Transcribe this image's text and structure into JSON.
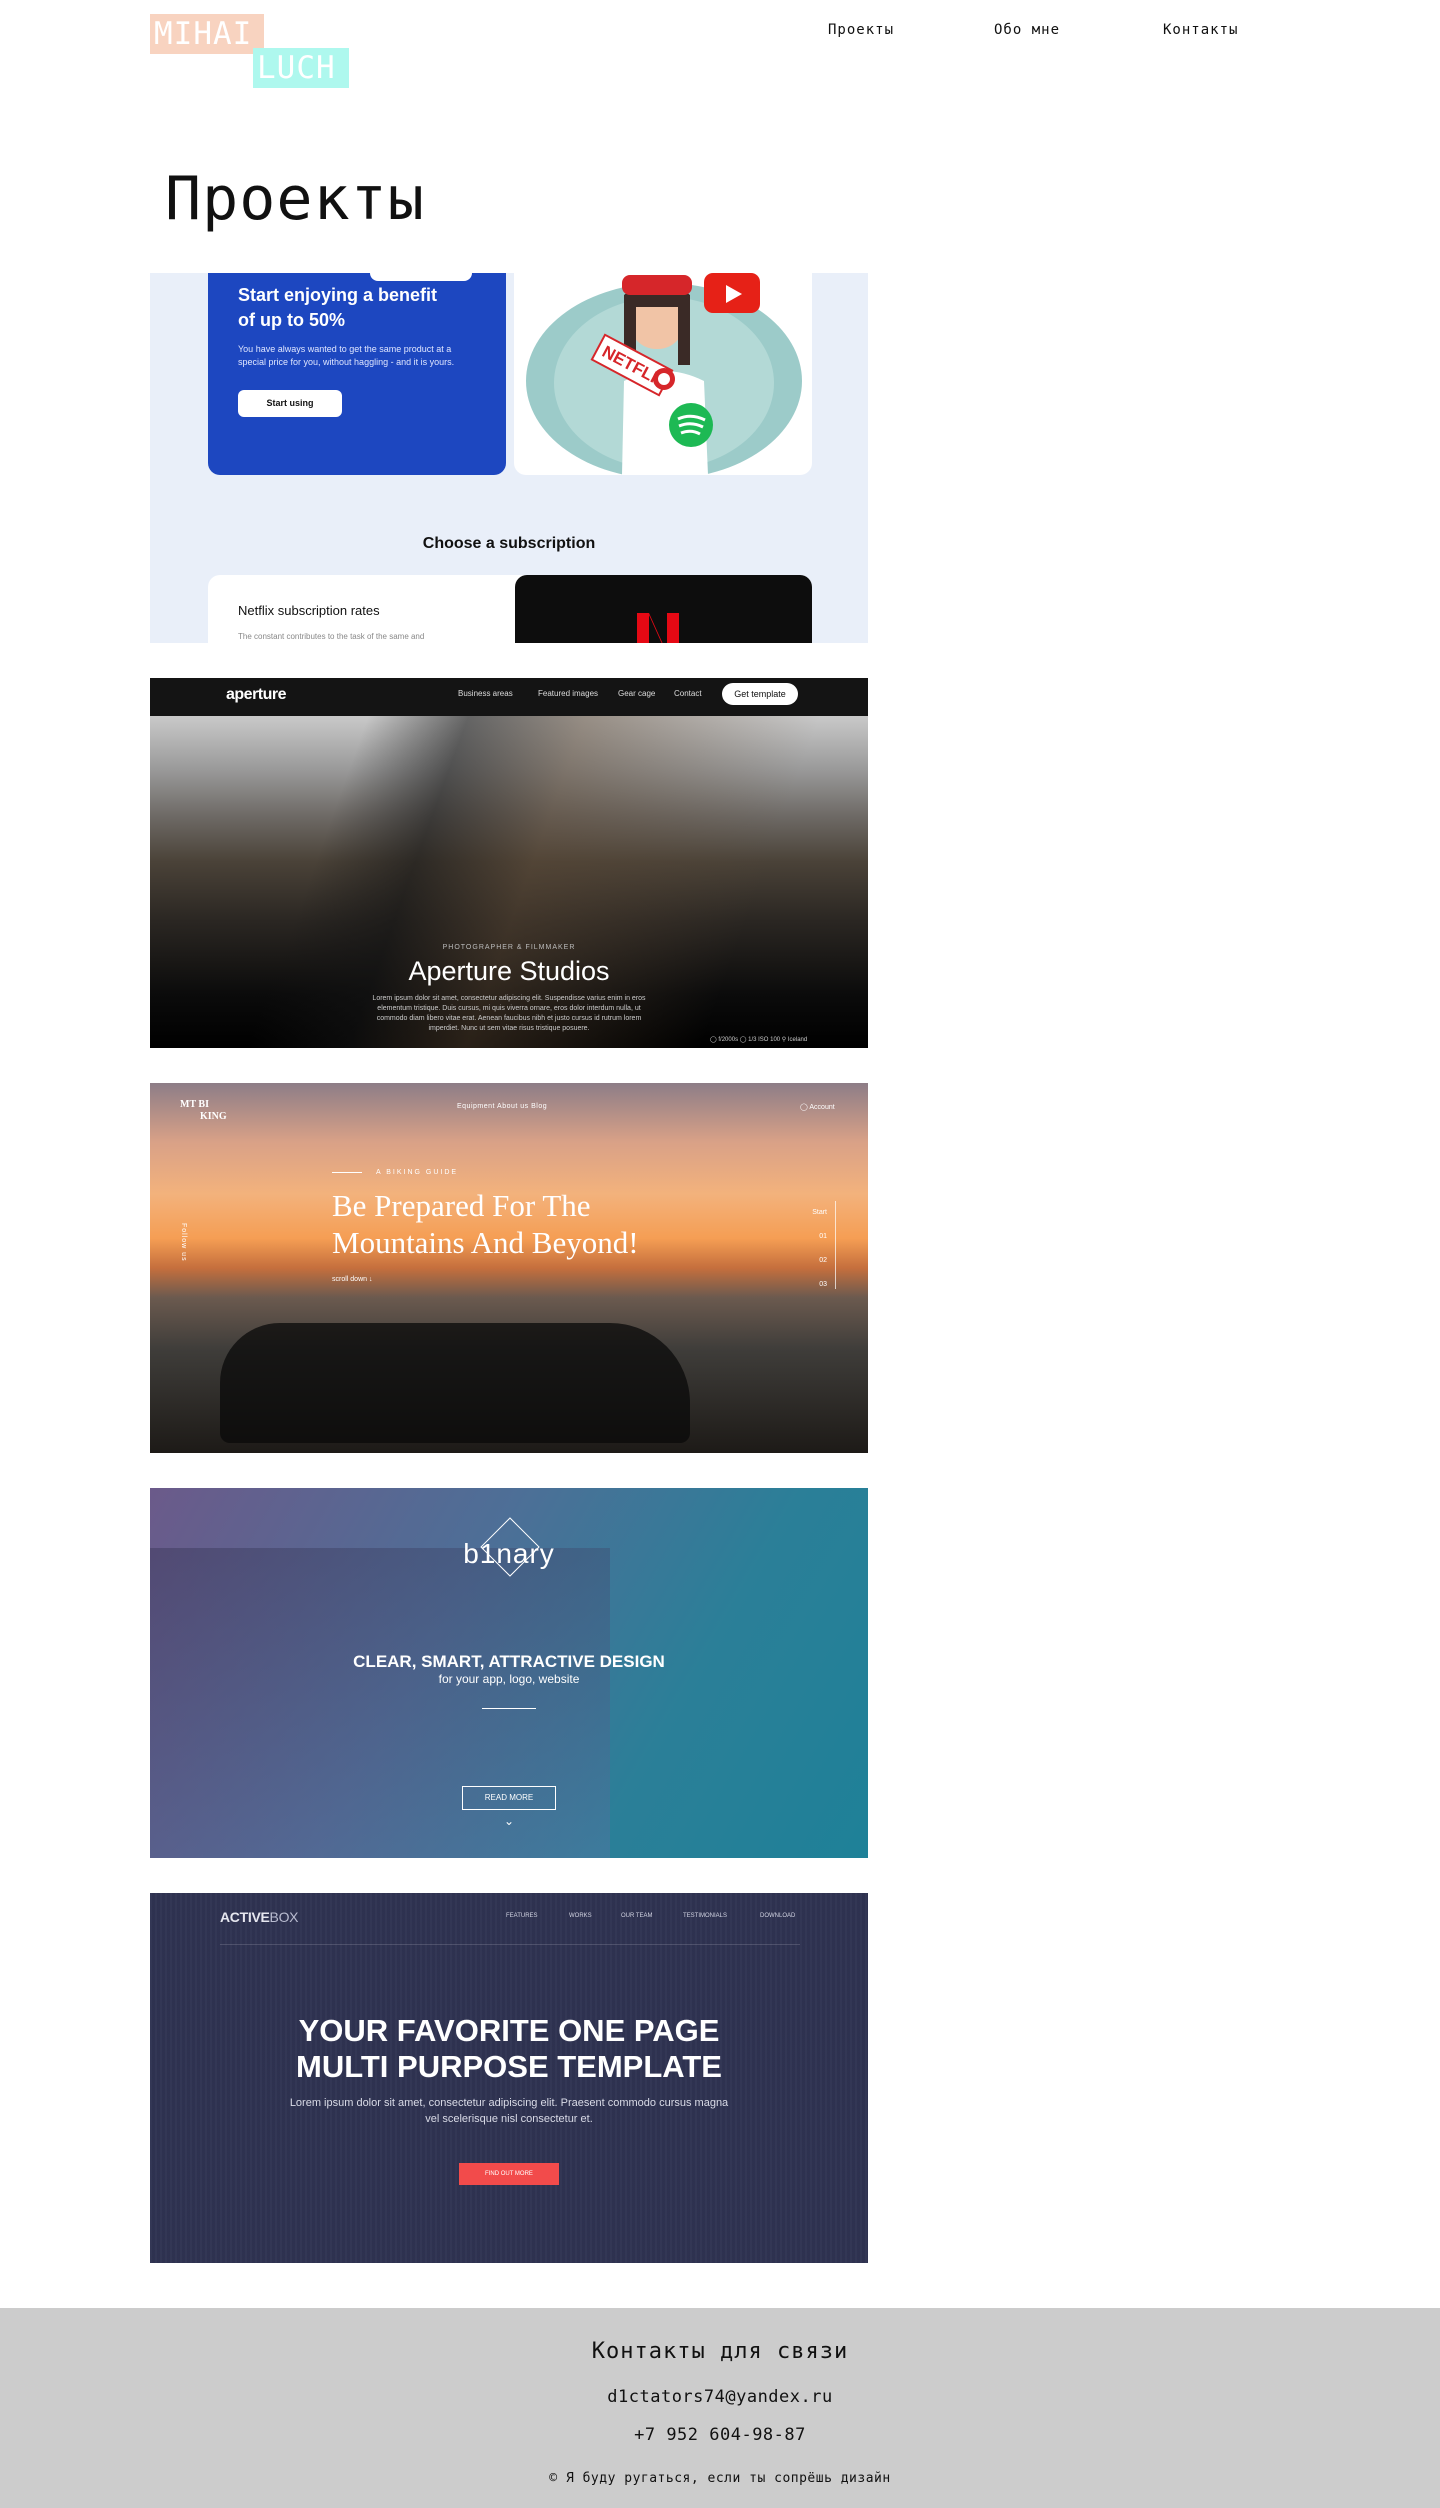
{
  "header": {
    "logo_top": "MIHAI",
    "logo_bottom": "LUCH",
    "nav": [
      "Проекты",
      "Обо мне",
      "Контакты"
    ]
  },
  "page_title": "Проекты",
  "projects": [
    {
      "headline_1": "Start enjoying a benefit",
      "headline_2": "of up to 50%",
      "description": "You have always wanted to get the same product at a special price for you, without haggling - and it is yours.",
      "button": "Start using",
      "section_title": "Choose a subscription",
      "rates_title": "Netflix subscription rates",
      "rates_text": "The constant contributes to the task of the same and",
      "illustration_text": "NETFLI"
    },
    {
      "brand": "aperture",
      "nav": [
        "Business areas",
        "Featured images",
        "Gear cage",
        "Contact"
      ],
      "cta": "Get template",
      "kicker": "PHOTOGRAPHER & FILMMAKER",
      "title": "Aperture Studios",
      "text": "Lorem ipsum dolor sit amet, consectetur adipiscing elit. Suspendisse varius enim in eros elementum tristique. Duis cursus, mi quis viverra ornare, eros dolor interdum nulla, ut commodo diam libero vitae erat. Aenean faucibus nibh et justo cursus id rutrum lorem imperdiet. Nunc ut sem vitae risus tristique posuere.",
      "stats": "◯ f/2000s   ◯ 1/3   ISO 100   ⚲ Iceland"
    },
    {
      "brand_1": "MT BI",
      "brand_2": "KING",
      "nav": "Equipment   About us   Blog",
      "account": "◯ Account",
      "kicker": "A BIKING GUIDE",
      "headline_1": "Be Prepared For The",
      "headline_2": "Mountains And Beyond!",
      "scroll": "scroll down ↓",
      "follow": "Follow us",
      "slides": [
        "Start",
        "01",
        "02",
        "03"
      ]
    },
    {
      "brand": "b1nary",
      "claim": "CLEAR, SMART, ATTRACTIVE DESIGN",
      "subclaim": "for your app, logo, website",
      "button": "READ MORE",
      "chevron": "⌄"
    },
    {
      "brand_bold": "ACTIVE",
      "brand_light": "BOX",
      "nav": [
        "FEATURES",
        "WORKS",
        "OUR TEAM",
        "TESTIMONIALS",
        "DOWNLOAD"
      ],
      "headline_1": "YOUR FAVORITE ONE PAGE",
      "headline_2": "MULTI PURPOSE TEMPLATE",
      "text_1": "Lorem ipsum dolor sit amet, consectetur adipiscing elit. Praesent commodo cursus magna",
      "text_2": "vel scelerisque nisl consectetur et.",
      "button": "FIND OUT MORE"
    }
  ],
  "footer": {
    "title": "Контакты для связи",
    "email": "d1ctators74@yandex.ru",
    "phone": "+7 952 604-98-87",
    "copyright": "© Я буду ругаться, если ты сопрёшь дизайн"
  },
  "colors": {
    "logo_top_bg": "#f8d3c0",
    "logo_bottom_bg": "#aef8ee",
    "footer_bg": "#cccccc",
    "card1_blue": "#1d47c0",
    "card5_cta": "#f24b4b"
  }
}
